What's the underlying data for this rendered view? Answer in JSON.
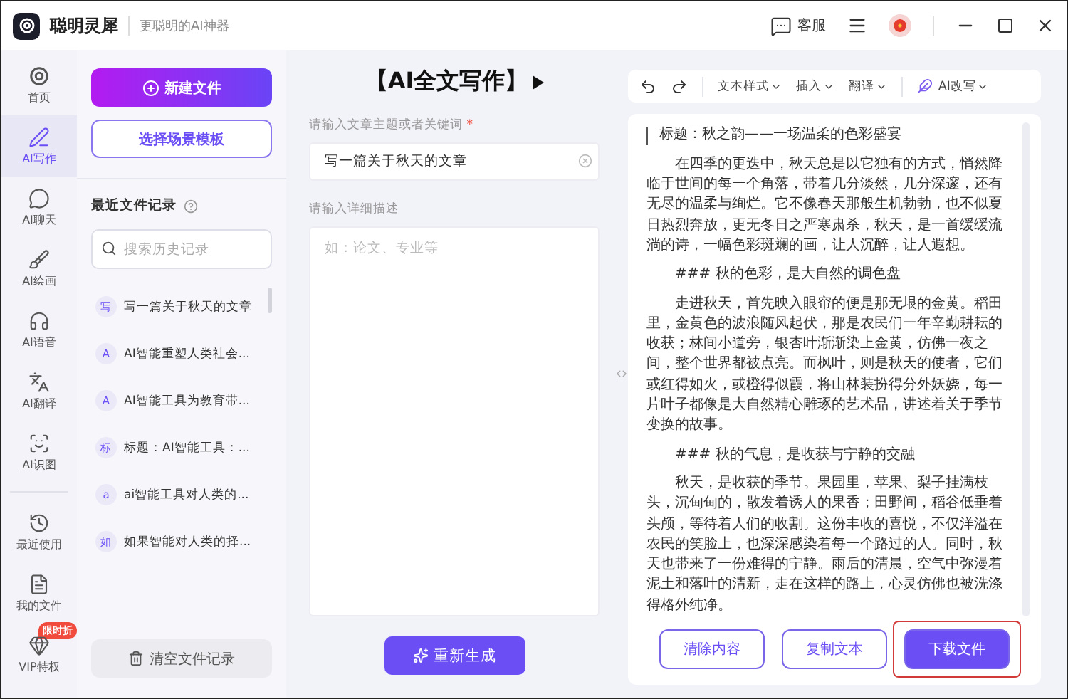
{
  "app": {
    "name": "聪明灵犀",
    "slogan": "更聪明的AI神器"
  },
  "header": {
    "support": "客服"
  },
  "nav": [
    {
      "label": "首页",
      "selected": false
    },
    {
      "label": "AI写作",
      "selected": true
    },
    {
      "label": "AI聊天",
      "selected": false
    },
    {
      "label": "AI绘画",
      "selected": false
    },
    {
      "label": "AI语音",
      "selected": false
    },
    {
      "label": "AI翻译",
      "selected": false
    },
    {
      "label": "AI识图",
      "selected": false
    }
  ],
  "nav_bottom": [
    {
      "label": "最近使用"
    },
    {
      "label": "我的文件"
    },
    {
      "label": "VIP特权",
      "badge": "限时折"
    }
  ],
  "sidebar": {
    "new_button": "新建文件",
    "template_button": "选择场景模板",
    "recent_title": "最近文件记录",
    "search": {
      "placeholder": "搜索历史记录"
    },
    "recent_files": [
      {
        "tag": "写",
        "title": "写一篇关于秋天的文章"
      },
      {
        "tag": "A",
        "title": "AI智能重塑人类社会..."
      },
      {
        "tag": "A",
        "title": "AI智能工具为教育带..."
      },
      {
        "tag": "标",
        "title": "标题：AI智能工具：..."
      },
      {
        "tag": "a",
        "title": "ai智能工具对人类的..."
      },
      {
        "tag": "如",
        "title": "如果智能对人类的择..."
      }
    ],
    "clear_button": "清空文件记录"
  },
  "editor": {
    "title": "【AI全文写作】",
    "topic": {
      "label": "请输入文章主题或者关键词",
      "required_mark": "*",
      "value": "写一篇关于秋天的文章"
    },
    "detail": {
      "label": "请输入详细描述",
      "placeholder": "如：论文、专业等"
    },
    "generate_button": "重新生成"
  },
  "toolbar": [
    {
      "kind": "undo"
    },
    {
      "kind": "redo"
    },
    {
      "kind": "menu",
      "label": "文本样式"
    },
    {
      "kind": "menu",
      "label": "插入"
    },
    {
      "kind": "menu",
      "label": "翻译"
    },
    {
      "kind": "ai",
      "label": "AI改写"
    }
  ],
  "document": [
    {
      "kind": "title",
      "text": "标题：秋之韵——一场温柔的色彩盛宴"
    },
    {
      "kind": "paragraph",
      "text": "在四季的更迭中，秋天总是以它独有的方式，悄然降临于世间的每一个角落，带着几分淡然，几分深邃，还有无尽的温柔与绚烂。它不像春天那般生机勃勃，也不似夏日热烈奔放，更无冬日之严寒肃杀，秋天，是一首缓缓流淌的诗，一幅色彩斑斓的画，让人沉醉，让人遐想。"
    },
    {
      "kind": "heading",
      "text": "### 秋的色彩，是大自然的调色盘"
    },
    {
      "kind": "paragraph",
      "text": "走进秋天，首先映入眼帘的便是那无垠的金黄。稻田里，金黄色的波浪随风起伏，那是农民们一年辛勤耕耘的收获；林间小道旁，银杏叶渐渐染上金黄，仿佛一夜之间，整个世界都被点亮。而枫叶，则是秋天的使者，它们或红得如火，或橙得似霞，将山林装扮得分外妖娆，每一片叶子都像是大自然精心雕琢的艺术品，讲述着关于季节变换的故事。"
    },
    {
      "kind": "heading",
      "text": "### 秋的气息，是收获与宁静的交融"
    },
    {
      "kind": "paragraph",
      "text": "秋天，是收获的季节。果园里，苹果、梨子挂满枝头，沉甸甸的，散发着诱人的果香；田野间，稻谷低垂着头颅，等待着人们的收割。这份丰收的喜悦，不仅洋溢在农民的笑脸上，也深深感染着每一个路过的人。同时，秋天也带来了一份难得的宁静。雨后的清晨，空气中弥漫着泥土和落叶的清新，走在这样的路上，心灵仿佛也被洗涤得格外纯净。"
    }
  ],
  "actions": [
    {
      "label": "清除内容",
      "kind": "outline",
      "highlighted": false
    },
    {
      "label": "复制文本",
      "kind": "outline",
      "highlighted": false
    },
    {
      "label": "下载文件",
      "kind": "primary",
      "highlighted": true
    }
  ]
}
